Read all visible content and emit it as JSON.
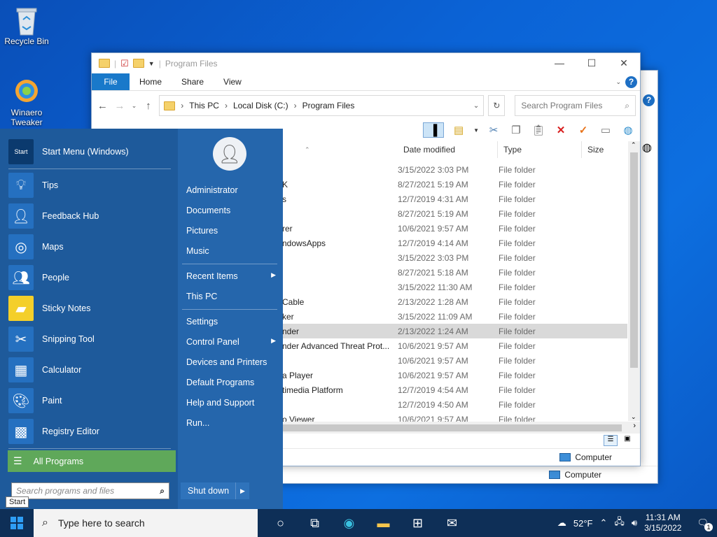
{
  "desktop": {
    "recycle_bin": "Recycle Bin",
    "winaero_line1": "Winaero",
    "winaero_line2": "Tweaker"
  },
  "explorer": {
    "title": "Program Files",
    "tabs": {
      "file": "File",
      "home": "Home",
      "share": "Share",
      "view": "View"
    },
    "help": "?",
    "address": [
      "This PC",
      "Local Disk (C:)",
      "Program Files"
    ],
    "search_placeholder": "Search Program Files",
    "columns": {
      "date": "Date modified",
      "type": "Type",
      "size": "Size"
    },
    "rows": [
      {
        "name": "",
        "date": "3/15/2022 3:03 PM",
        "type": "File folder"
      },
      {
        "name": "K",
        "date": "8/27/2021 5:19 AM",
        "type": "File folder"
      },
      {
        "name": "s",
        "date": "12/7/2019 4:31 AM",
        "type": "File folder"
      },
      {
        "name": "",
        "date": "8/27/2021 5:19 AM",
        "type": "File folder"
      },
      {
        "name": "rer",
        "date": "10/6/2021 9:57 AM",
        "type": "File folder"
      },
      {
        "name": "ndowsApps",
        "date": "12/7/2019 4:14 AM",
        "type": "File folder"
      },
      {
        "name": "",
        "date": "3/15/2022 3:03 PM",
        "type": "File folder"
      },
      {
        "name": "",
        "date": "8/27/2021 5:18 AM",
        "type": "File folder"
      },
      {
        "name": "",
        "date": "3/15/2022 11:30 AM",
        "type": "File folder"
      },
      {
        "name": "Cable",
        "date": "2/13/2022 1:28 AM",
        "type": "File folder"
      },
      {
        "name": "ker",
        "date": "3/15/2022 11:09 AM",
        "type": "File folder"
      },
      {
        "name": "nder",
        "date": "2/13/2022 1:24 AM",
        "type": "File folder"
      },
      {
        "name": "nder Advanced Threat Prot...",
        "date": "10/6/2021 9:57 AM",
        "type": "File folder"
      },
      {
        "name": "",
        "date": "10/6/2021 9:57 AM",
        "type": "File folder"
      },
      {
        "name": "a Player",
        "date": "10/6/2021 9:57 AM",
        "type": "File folder"
      },
      {
        "name": "timedia Platform",
        "date": "12/7/2019 4:54 AM",
        "type": "File folder"
      },
      {
        "name": "",
        "date": "12/7/2019 4:50 AM",
        "type": "File folder"
      },
      {
        "name": "o Viewer",
        "date": "10/6/2021 9:57 AM",
        "type": "File folder"
      }
    ],
    "status": "Computer",
    "back_status": "Computer"
  },
  "start_menu": {
    "header_badge": "Start",
    "apps": [
      {
        "label": "Start Menu (Windows)",
        "icon": "start-menu-icon"
      },
      {
        "label": "Tips",
        "icon": "lightbulb-icon"
      },
      {
        "label": "Feedback Hub",
        "icon": "feedback-icon"
      },
      {
        "label": "Maps",
        "icon": "maps-icon"
      },
      {
        "label": "People",
        "icon": "people-icon"
      },
      {
        "label": "Sticky Notes",
        "icon": "sticky-notes-icon"
      },
      {
        "label": "Snipping Tool",
        "icon": "snipping-icon"
      },
      {
        "label": "Calculator",
        "icon": "calculator-icon"
      },
      {
        "label": "Paint",
        "icon": "paint-icon"
      },
      {
        "label": "Registry Editor",
        "icon": "registry-icon"
      }
    ],
    "all_programs": "All Programs",
    "search_placeholder": "Search programs and files",
    "right_items": [
      {
        "label": "Administrator"
      },
      {
        "label": "Documents"
      },
      {
        "label": "Pictures"
      },
      {
        "label": "Music"
      },
      {
        "label": "Recent Items",
        "arrow": true
      },
      {
        "label": "This PC"
      },
      {
        "label": "Settings"
      },
      {
        "label": "Control Panel",
        "arrow": true
      },
      {
        "label": "Devices and Printers"
      },
      {
        "label": "Default Programs"
      },
      {
        "label": "Help and Support"
      },
      {
        "label": "Run..."
      }
    ],
    "shutdown": "Shut down",
    "tooltip": "Start"
  },
  "taskbar": {
    "search_placeholder": "Type here to search",
    "weather": "52°F",
    "time": "11:31 AM",
    "date": "3/15/2022",
    "notifications": "1"
  }
}
